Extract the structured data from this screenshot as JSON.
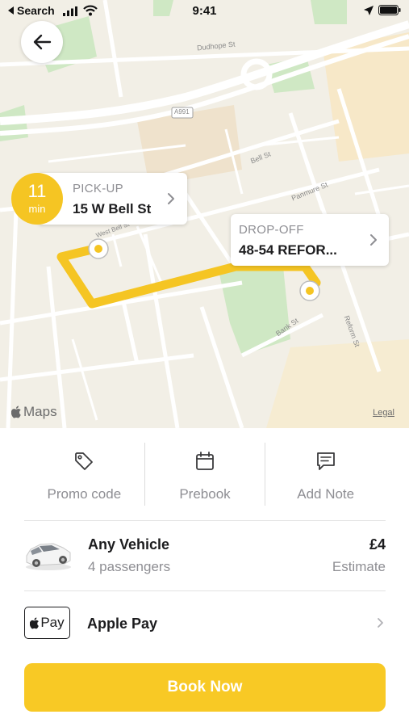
{
  "status_bar": {
    "back_app": "Search",
    "time": "9:41"
  },
  "map": {
    "streets": [
      "Dudhope St",
      "A991",
      "Bell St",
      "Panmure St",
      "West Bell St",
      "Bank St",
      "Reform St"
    ],
    "attribution": "Maps",
    "legal": "Legal"
  },
  "eta": {
    "value": "11",
    "unit": "min"
  },
  "pickup": {
    "label": "PICK-UP",
    "address": "15 W Bell St"
  },
  "dropoff": {
    "label": "DROP-OFF",
    "address": "48-54 REFOR..."
  },
  "actions": [
    {
      "label": "Promo code",
      "icon": "tag-icon"
    },
    {
      "label": "Prebook",
      "icon": "calendar-icon"
    },
    {
      "label": "Add Note",
      "icon": "note-icon"
    }
  ],
  "vehicle": {
    "name": "Any Vehicle",
    "passengers": "4 passengers",
    "price": "£4",
    "price_note": "Estimate"
  },
  "payment": {
    "badge": "Pay",
    "label": "Apple Pay"
  },
  "book_button": "Book Now",
  "colors": {
    "accent": "#f8c925",
    "route": "#f5c523",
    "park": "#cfe8c4",
    "land": "#f2efe6"
  }
}
